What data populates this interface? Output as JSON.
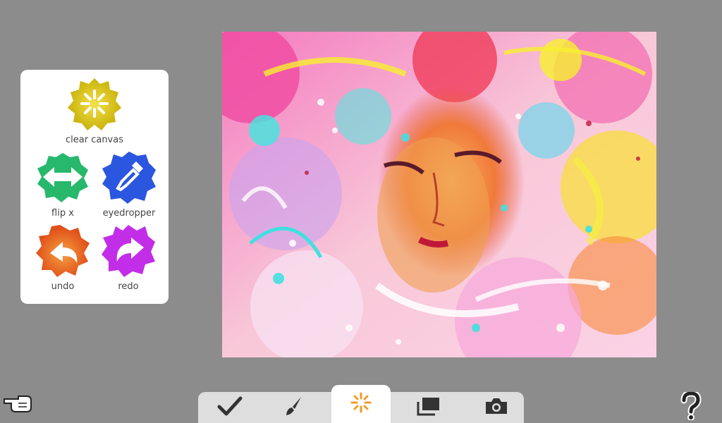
{
  "tools": {
    "clear_canvas": "clear canvas",
    "flip_x": "flip x",
    "eyedropper": "eyedropper",
    "undo": "undo",
    "redo": "redo"
  },
  "toolbar": {
    "items": [
      "confirm",
      "brush",
      "tools",
      "layers",
      "camera"
    ],
    "active": "tools"
  },
  "colors": {
    "background": "#8c8c8c",
    "clear_canvas": "#e6d21a",
    "flip_x": "#2fbf6a",
    "eyedropper": "#2a56e0",
    "undo": "#f07a1a",
    "redo": "#c22ee8",
    "active_tool_icon": "#f39a2a"
  }
}
